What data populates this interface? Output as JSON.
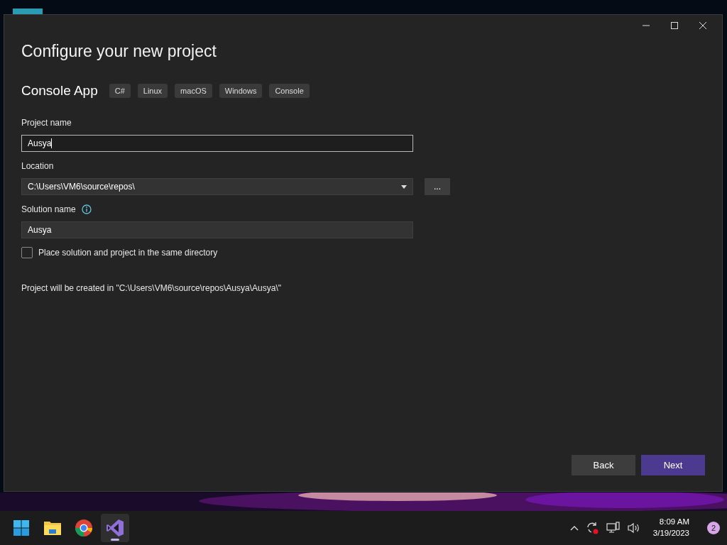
{
  "window": {
    "title": "Configure your new project"
  },
  "template": {
    "name": "Console App",
    "tags": [
      "C#",
      "Linux",
      "macOS",
      "Windows",
      "Console"
    ]
  },
  "project_name": {
    "label": "Project name",
    "value": "Ausya"
  },
  "location": {
    "label": "Location",
    "value": "C:\\Users\\VM6\\source\\repos\\",
    "browse": "..."
  },
  "solution_name": {
    "label": "Solution name",
    "value": "Ausya"
  },
  "same_directory": {
    "label": "Place solution and project in the same directory",
    "checked": false
  },
  "summary": "Project will be created in \"C:\\Users\\VM6\\source\\repos\\Ausya\\Ausya\\\"",
  "buttons": [
    {
      "label": "Back",
      "kind": "secondary"
    },
    {
      "label": "Next",
      "kind": "primary"
    }
  ],
  "taskbar": {
    "apps": [
      {
        "kind": "start",
        "selected": false
      },
      {
        "kind": "folder",
        "selected": false
      },
      {
        "kind": "browser",
        "selected": false
      },
      {
        "kind": "ide",
        "selected": true
      }
    ],
    "time": "8:09 AM",
    "date": "3/19/2023",
    "notifications": "2"
  }
}
